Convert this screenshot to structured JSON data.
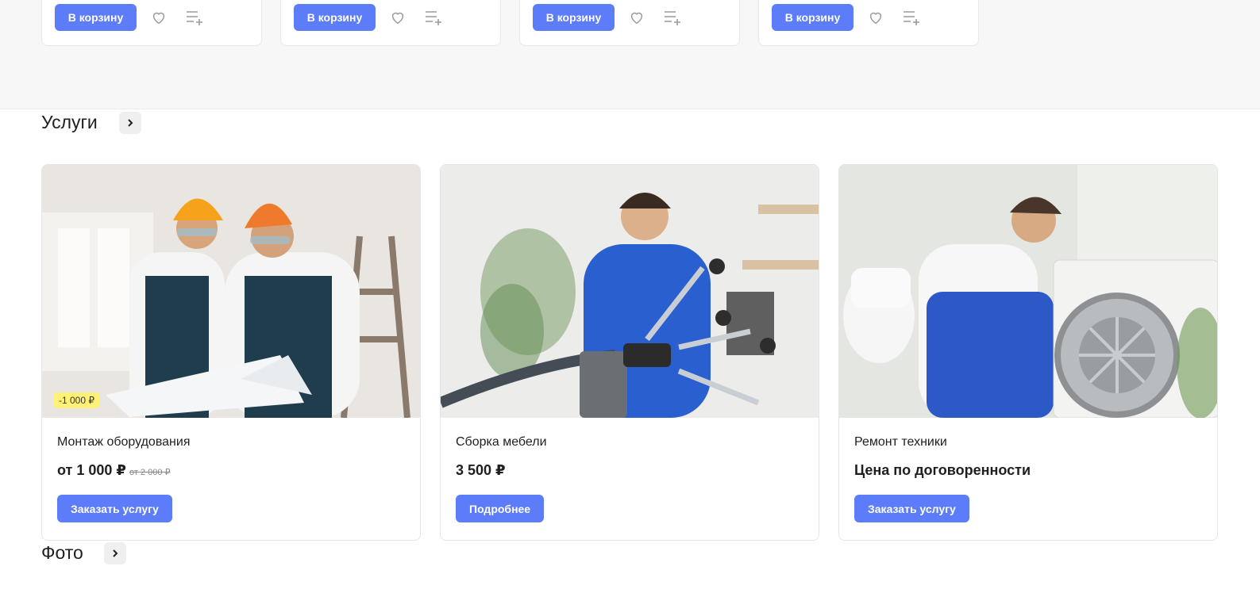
{
  "products": [
    {
      "cart_label": "В корзину",
      "fav_icon": "heart-icon",
      "compare_icon": "compare-list-icon"
    },
    {
      "cart_label": "В корзину",
      "fav_icon": "heart-icon",
      "compare_icon": "compare-list-icon"
    },
    {
      "cart_label": "В корзину",
      "fav_icon": "heart-icon",
      "compare_icon": "compare-list-icon"
    },
    {
      "cart_label": "В корзину",
      "fav_icon": "heart-icon",
      "compare_icon": "compare-list-icon"
    }
  ],
  "services_section": {
    "title": "Услуги",
    "arrow_icon": "chevron-right-icon"
  },
  "services": [
    {
      "name": "Монтаж оборудования",
      "price": "от 1 000 ₽",
      "old_price": "от 2 000 ₽",
      "badge": "-1 000 ₽",
      "button": "Заказать услугу"
    },
    {
      "name": "Сборка мебели",
      "price": "3 500 ₽",
      "old_price": "",
      "badge": "",
      "button": "Подробнее"
    },
    {
      "name": "Ремонт техники",
      "price": "Цена по договоренности",
      "old_price": "",
      "badge": "",
      "button": "Заказать услугу"
    }
  ],
  "photo_section": {
    "title": "Фото",
    "arrow_icon": "chevron-right-icon"
  },
  "colors": {
    "accent": "#5c7cfa",
    "badge": "#fff176",
    "band": "#f7f7f7"
  }
}
